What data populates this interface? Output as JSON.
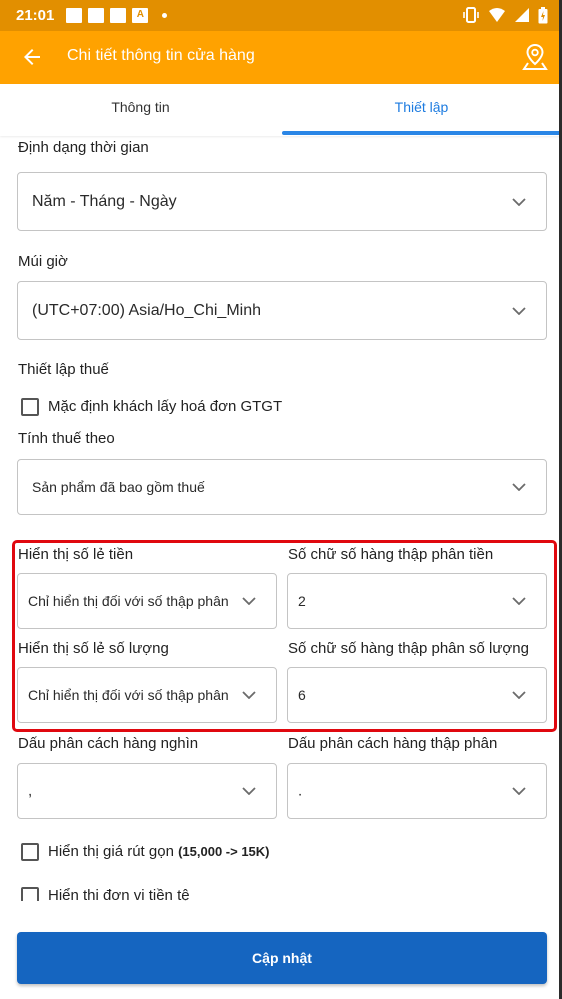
{
  "status_bar": {
    "time": "21:01",
    "notif_letter": "A"
  },
  "app_bar": {
    "title": "Chi tiết thông tin cửa hàng"
  },
  "tabs": [
    {
      "label": "Thông tin",
      "active": false
    },
    {
      "label": "Thiết lập",
      "active": true
    }
  ],
  "form": {
    "time_format": {
      "label": "Định dạng thời gian",
      "value": "Năm - Tháng - Ngày"
    },
    "timezone": {
      "label": "Múi giờ",
      "value": "(UTC+07:00) Asia/Ho_Chi_Minh"
    },
    "tax_settings": {
      "label": "Thiết lập thuế",
      "default_vat_invoice": {
        "label": "Mặc định khách lấy hoá đơn GTGT",
        "checked": false
      }
    },
    "tax_calc": {
      "label": "Tính thuế theo",
      "value": "Sản phẩm đã bao gồm thuế"
    },
    "money_decimal_display": {
      "label": "Hiển thị số lẻ tiền",
      "value": "Chỉ hiển thị đối với số thập phân"
    },
    "money_decimal_digits": {
      "label": "Số chữ số hàng thập phân tiền",
      "value": "2"
    },
    "qty_decimal_display": {
      "label": "Hiển thị số lẻ số lượng",
      "value": "Chỉ hiển thị đối với số thập phân"
    },
    "qty_decimal_digits": {
      "label": "Số chữ số hàng thập phân số lượng",
      "value": "6"
    },
    "thousands_sep": {
      "label": "Dấu phân cách hàng nghìn",
      "value": ","
    },
    "decimal_sep": {
      "label": "Dấu phân cách hàng thập phân",
      "value": "."
    },
    "short_price": {
      "label": "Hiển thị giá rút gọn",
      "hint": "(15,000 -> 15K)",
      "checked": false
    },
    "currency_unit": {
      "label": "Hiển thị đơn vị tiền tệ",
      "checked": false
    }
  },
  "update_button": {
    "label": "Cập nhật"
  },
  "colors": {
    "status_bar": "#e28f00",
    "app_bar": "#ffa200",
    "accent": "#1565c0",
    "highlight": "#e0080f"
  }
}
